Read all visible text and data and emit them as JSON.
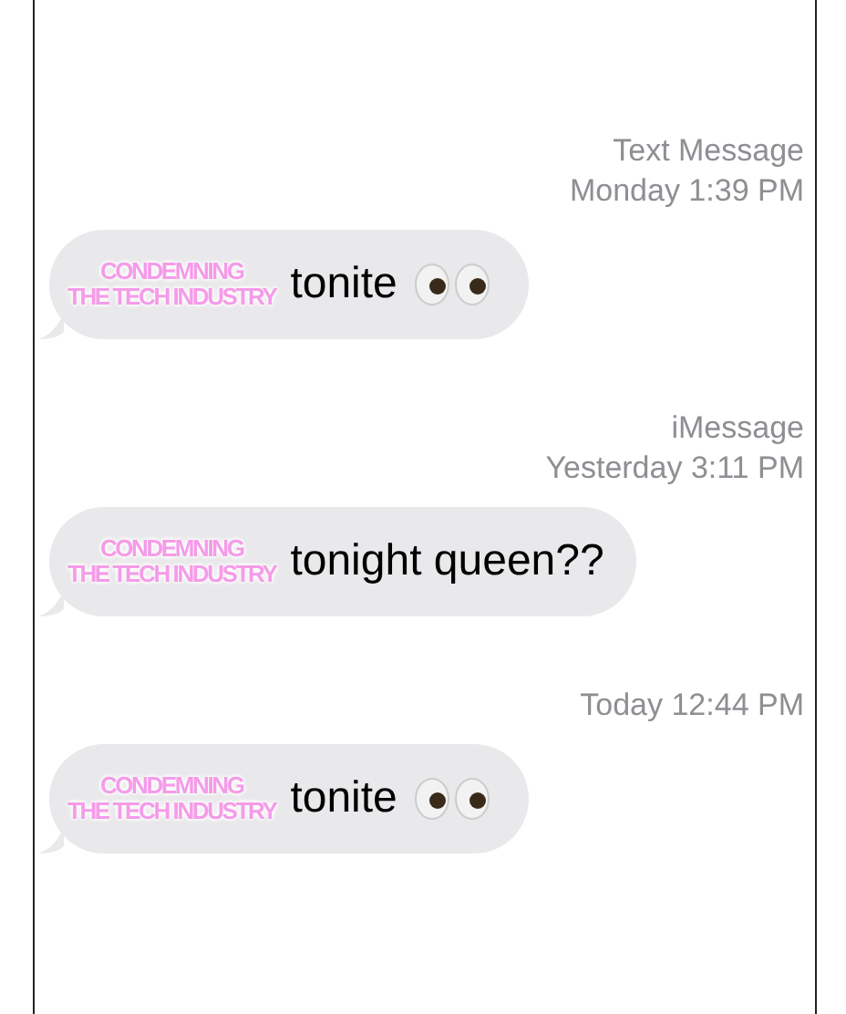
{
  "messages": [
    {
      "header": [
        "Text Message",
        "Monday 1:39 PM"
      ],
      "overlay": [
        "CONDEMNING",
        "THE TECH INDUSTRY"
      ],
      "text": "tonite",
      "eyes_emoji": true
    },
    {
      "header": [
        "iMessage",
        "Yesterday 3:11 PM"
      ],
      "overlay": [
        "CONDEMNING",
        "THE TECH INDUSTRY"
      ],
      "text": "tonight queen??",
      "eyes_emoji": false
    },
    {
      "header": [
        "Today 12:44 PM"
      ],
      "overlay": [
        "CONDEMNING",
        "THE TECH INDUSTRY"
      ],
      "text": "tonite",
      "eyes_emoji": true
    }
  ]
}
